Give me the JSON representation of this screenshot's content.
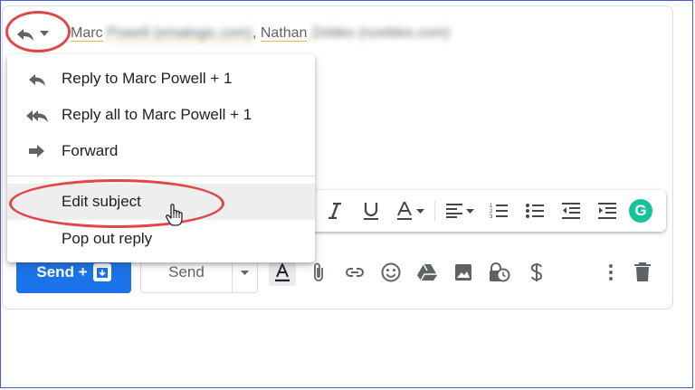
{
  "header": {
    "to_first_name": "Marc",
    "to_first_rest": "Powell (emalogic.com)",
    "separator": ",",
    "to_second_name": "Nathan",
    "to_second_rest": "Zeldes (nzeldes.com)"
  },
  "reply_menu": {
    "items": [
      {
        "label": "Reply to Marc Powell + 1",
        "icon": "reply-icon"
      },
      {
        "label": "Reply all to Marc Powell + 1",
        "icon": "reply-all-icon"
      },
      {
        "label": "Forward",
        "icon": "forward-icon"
      },
      {
        "label": "Edit subject",
        "icon": ""
      },
      {
        "label": "Pop out reply",
        "icon": ""
      }
    ],
    "hovered_item": "Edit subject"
  },
  "format_toolbar": {
    "tools": [
      "italic-icon",
      "underline-icon",
      "text-color-icon",
      "align-icon",
      "numbered-list-icon",
      "bulleted-list-icon",
      "indent-less-icon",
      "indent-more-icon"
    ],
    "grammarly_label": "G",
    "grammarly_color": "#15c39a"
  },
  "bottom_toolbar": {
    "send_schedule_label": "Send +",
    "send_label": "Send",
    "tools": [
      "formatting-icon",
      "attach-icon",
      "link-icon",
      "emoji-icon",
      "drive-icon",
      "photo-icon",
      "confidential-icon",
      "money-icon",
      "more-options-icon",
      "discard-icon"
    ]
  },
  "colors": {
    "accent": "#1a73e8",
    "annotation": "#e0464a",
    "frame": "#4a5ad8"
  }
}
